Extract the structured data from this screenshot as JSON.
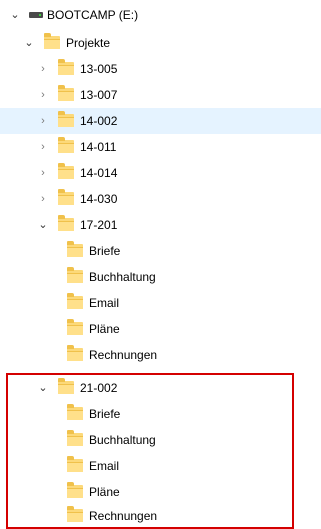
{
  "tree": {
    "drive": {
      "label": "BOOTCAMP (E:)"
    },
    "projekte": {
      "label": "Projekte"
    },
    "folders": [
      {
        "label": "13-005"
      },
      {
        "label": "13-007"
      },
      {
        "label": "14-002",
        "selected": true
      },
      {
        "label": "14-011"
      },
      {
        "label": "14-014"
      },
      {
        "label": "14-030"
      }
    ],
    "expanded1": {
      "label": "17-201",
      "children": [
        "Briefe",
        "Buchhaltung",
        "Email",
        "Pläne",
        "Rechnungen"
      ]
    },
    "expanded2": {
      "label": "21-002",
      "children": [
        "Briefe",
        "Buchhaltung",
        "Email",
        "Pläne",
        "Rechnungen"
      ]
    }
  },
  "colors": {
    "selection": "#e5f3ff",
    "annotation_border": "#d40000",
    "folder": "#fcd97a"
  },
  "icons": {
    "expand": "chevron-right-icon",
    "collapse": "chevron-down-icon",
    "drive": "drive-icon",
    "folder": "folder-icon"
  }
}
